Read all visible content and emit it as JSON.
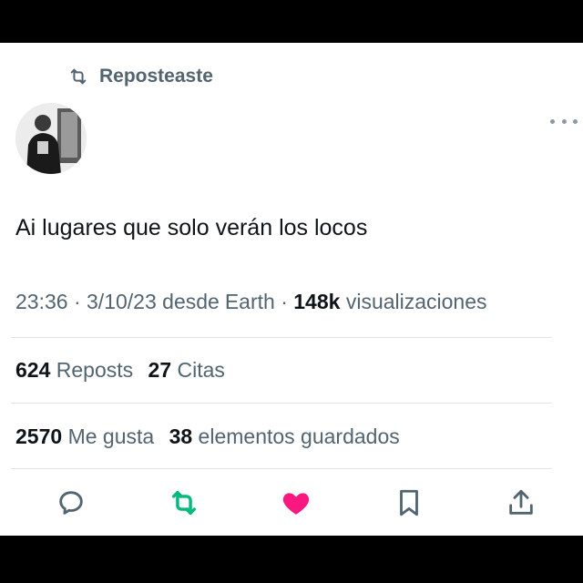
{
  "repost": {
    "label": "Reposteaste",
    "icon": "repost-icon"
  },
  "author": {
    "avatar": "avatar-photo",
    "more_icon": "more-icon"
  },
  "tweet": {
    "text": "Ai lugares que solo verán los locos"
  },
  "meta": {
    "time": "23:36",
    "sep1": "·",
    "date": "3/10/23",
    "source_prefix": "desde",
    "source": "Earth",
    "sep2": "·",
    "views_count": "148k",
    "views_label": "visualizaciones"
  },
  "stats": {
    "reposts_count": "624",
    "reposts_label": "Reposts",
    "quotes_count": "27",
    "quotes_label": "Citas",
    "likes_count": "2570",
    "likes_label": "Me gusta",
    "bookmarks_count": "38",
    "bookmarks_label": "elementos guardados"
  },
  "actions": {
    "reply_icon": "reply-icon",
    "repost_icon": "repost-icon",
    "like_icon": "heart-icon",
    "bookmark_icon": "bookmark-icon",
    "share_icon": "share-icon",
    "repost_color": "#00ba7c",
    "like_color": "#f91880",
    "icon_color": "#536471"
  }
}
